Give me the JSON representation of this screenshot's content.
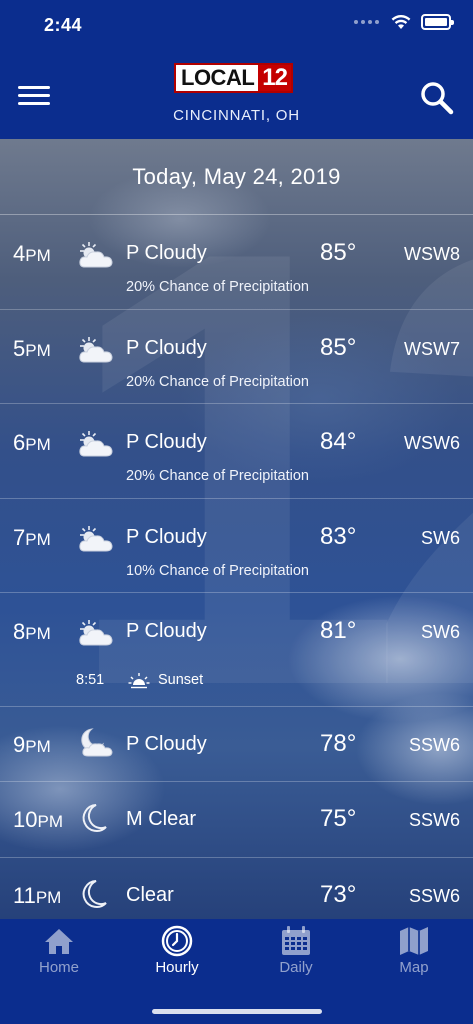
{
  "status_bar": {
    "time": "2:44"
  },
  "header": {
    "logo": {
      "word": "LOCAL",
      "number": "12"
    },
    "location": "CINCINNATI, OH",
    "menu_icon": "hamburger-menu-icon",
    "search_icon": "search-icon"
  },
  "date_heading": "Today, May 24, 2019",
  "hourly": [
    {
      "hour": "4",
      "ampm": "PM",
      "icon": "partly-cloudy-sun-icon",
      "condition": "P Cloudy",
      "temp": "85°",
      "wind": "WSW8",
      "precip": "20% Chance of Precipitation"
    },
    {
      "hour": "5",
      "ampm": "PM",
      "icon": "partly-cloudy-sun-icon",
      "condition": "P Cloudy",
      "temp": "85°",
      "wind": "WSW7",
      "precip": "20% Chance of Precipitation"
    },
    {
      "hour": "6",
      "ampm": "PM",
      "icon": "partly-cloudy-sun-icon",
      "condition": "P Cloudy",
      "temp": "84°",
      "wind": "WSW6",
      "precip": "20% Chance of Precipitation"
    },
    {
      "hour": "7",
      "ampm": "PM",
      "icon": "partly-cloudy-sun-icon",
      "condition": "P Cloudy",
      "temp": "83°",
      "wind": "SW6",
      "precip": "10% Chance of Precipitation"
    },
    {
      "hour": "8",
      "ampm": "PM",
      "icon": "partly-cloudy-sun-icon",
      "condition": "P Cloudy",
      "temp": "81°",
      "wind": "SW6",
      "sunset_time": "8:51",
      "sunset_label": "Sunset"
    },
    {
      "hour": "9",
      "ampm": "PM",
      "icon": "partly-cloudy-moon-icon",
      "condition": "P Cloudy",
      "temp": "78°",
      "wind": "SSW6"
    },
    {
      "hour": "10",
      "ampm": "PM",
      "icon": "moon-icon",
      "condition": "M Clear",
      "temp": "75°",
      "wind": "SSW6"
    },
    {
      "hour": "11",
      "ampm": "PM",
      "icon": "moon-icon",
      "condition": "Clear",
      "temp": "73°",
      "wind": "SSW6"
    }
  ],
  "tabs": [
    {
      "label": "Home",
      "icon": "home-icon",
      "active": false
    },
    {
      "label": "Hourly",
      "icon": "clock-icon",
      "active": true
    },
    {
      "label": "Daily",
      "icon": "calendar-icon",
      "active": false
    },
    {
      "label": "Map",
      "icon": "map-icon",
      "active": false
    }
  ],
  "colors": {
    "brand_blue": "#0b2d8e",
    "logo_red": "#c40000"
  }
}
